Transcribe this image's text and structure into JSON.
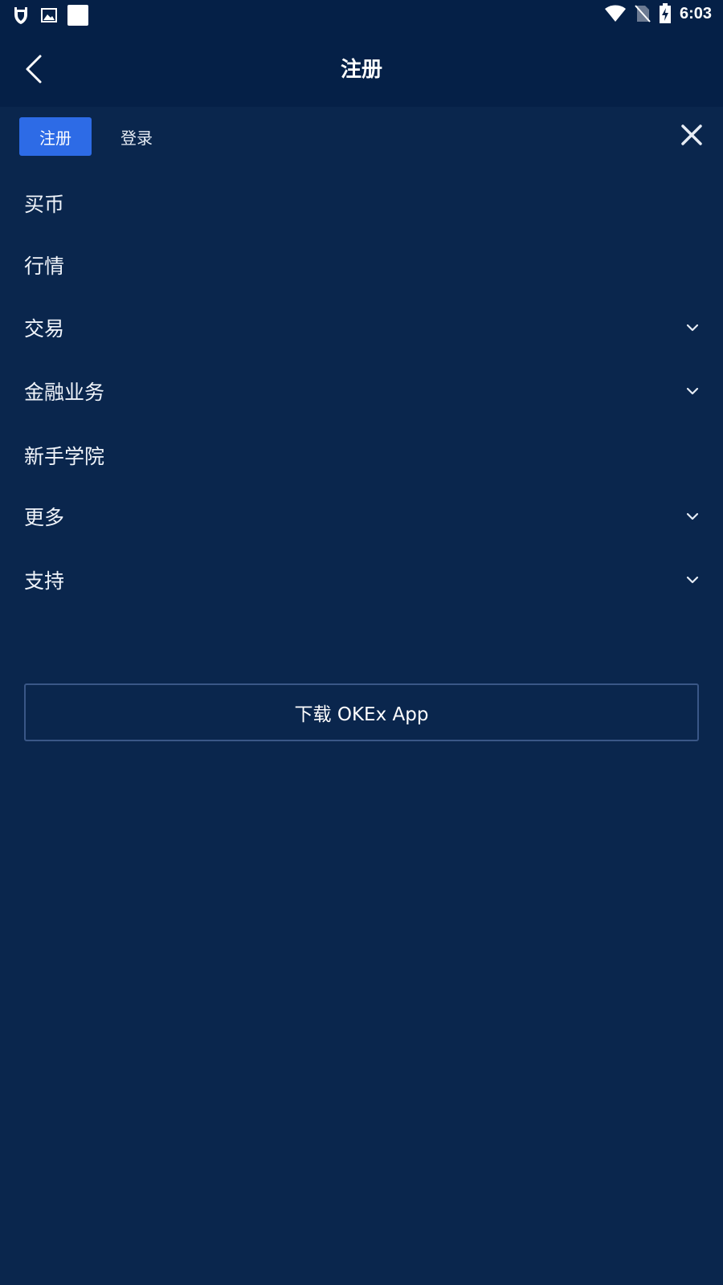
{
  "status_bar": {
    "time": "6:03",
    "icons": [
      "shield-icon",
      "image-icon",
      "white-square-icon",
      "wifi-icon",
      "no-sim-icon",
      "battery-charging-icon"
    ]
  },
  "header": {
    "title": "注册"
  },
  "tabs": {
    "register": "注册",
    "login": "登录"
  },
  "menu": {
    "items": [
      {
        "label": "买币",
        "expandable": false
      },
      {
        "label": "行情",
        "expandable": false
      },
      {
        "label": "交易",
        "expandable": true
      },
      {
        "label": "金融业务",
        "expandable": true
      },
      {
        "label": "新手学院",
        "expandable": false
      },
      {
        "label": "更多",
        "expandable": true
      },
      {
        "label": "支持",
        "expandable": true
      }
    ]
  },
  "download": {
    "label": "下载 OKEx App"
  },
  "colors": {
    "background": "#0a264d",
    "header": "#052047",
    "accent": "#2d6be6",
    "border": "#3a5787"
  }
}
